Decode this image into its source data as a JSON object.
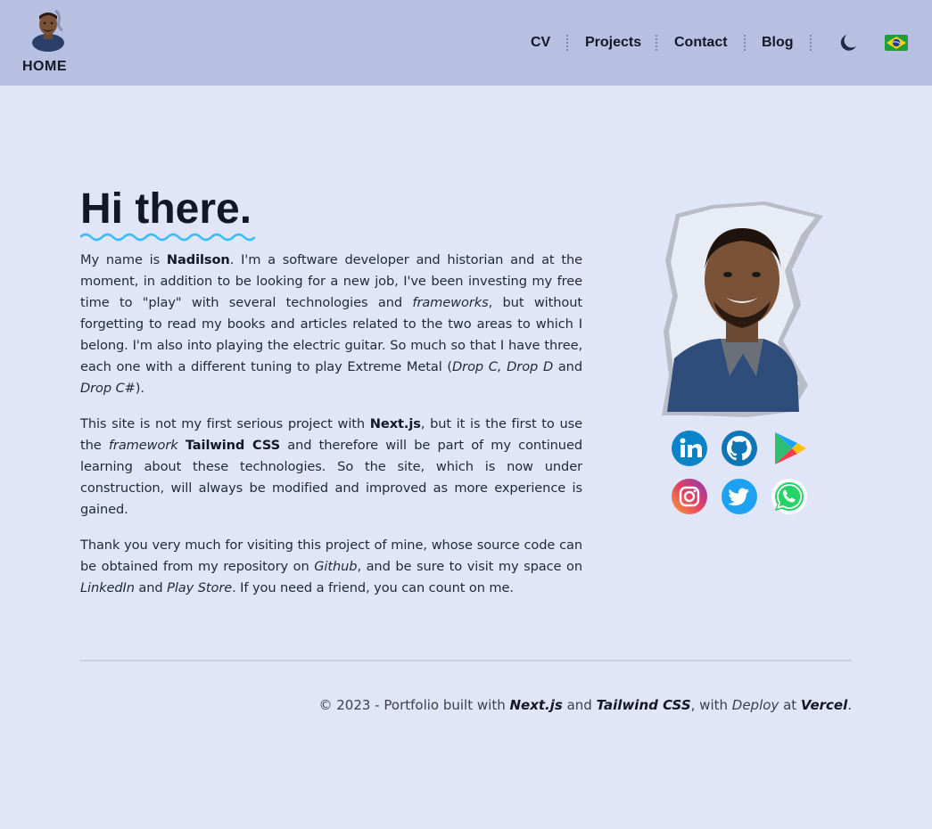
{
  "header": {
    "home_label": "HOME",
    "nav": [
      {
        "label": "CV"
      },
      {
        "label": "Projects"
      },
      {
        "label": "Contact"
      },
      {
        "label": "Blog"
      }
    ],
    "theme_icon": "moon-icon",
    "language_icon": "brazil-flag-icon"
  },
  "main": {
    "title": "Hi there.",
    "p1": {
      "t1": "My name is ",
      "name": "Nadilson",
      "t2": ". I'm a software developer and historian and at the moment, in addition to be looking for a new job, I've been investing my free time to \"play\" with several technologies and ",
      "i1": "frameworks",
      "t3": ", but without forgetting to read my books and articles related to the two areas to which I belong. I'm also into playing the electric guitar. So much so that I have three, each one with a different tuning to play Extreme Metal (",
      "i2": "Drop C, Drop D",
      "t4": " and ",
      "i3": "Drop C#",
      "t5": ")."
    },
    "p2": {
      "t1": "This site is not my first serious project with ",
      "b1": "Next.js",
      "t2": ", but it is the first to use the ",
      "i1": "framework",
      "t3": " ",
      "b2": "Tailwind CSS",
      "t4": " and therefore will be part of my continued learning about these technologies. So the site, which is now under construction, will always be modified and improved as more experience is gained."
    },
    "p3": {
      "t1": "Thank you very much for visiting this project of mine, whose source code can be obtained from my repository on ",
      "i1": "Github",
      "t2": ", and be sure to visit my space on ",
      "i2": "LinkedIn",
      "t3": " and ",
      "i3": "Play Store",
      "t4": ". If you need a friend, you can count on me."
    },
    "social": [
      "linkedin-icon",
      "github-icon",
      "play-store-icon",
      "instagram-icon",
      "twitter-icon",
      "whatsapp-icon"
    ]
  },
  "footer": {
    "t1": "© 2023 - Portfolio built with ",
    "b1": "Next.js",
    "t2": " and ",
    "b2": "Tailwind CSS",
    "t3": ", with ",
    "i1": "Deploy",
    "t4": " at ",
    "b3": "Vercel",
    "t5": "."
  },
  "colors": {
    "header_bg": "#b7c0e1",
    "page_bg": "#e0e6f7",
    "accent_wave": "#38bdf8",
    "text": "#111827"
  }
}
